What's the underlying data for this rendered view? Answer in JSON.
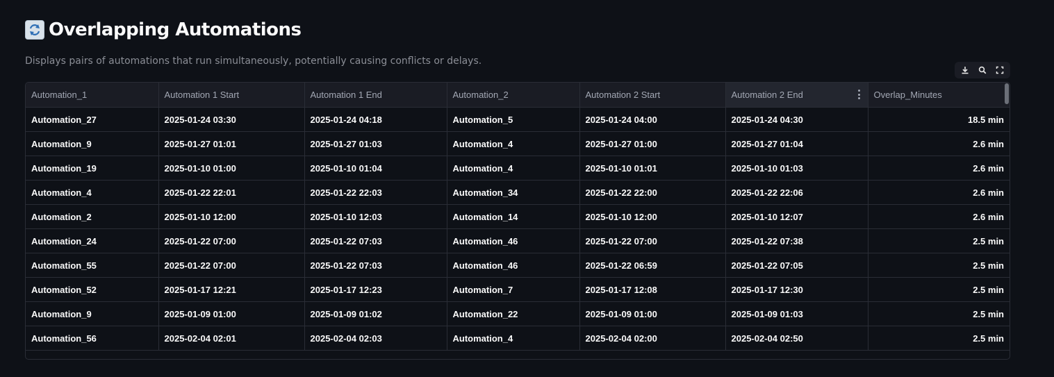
{
  "header": {
    "title": "Overlapping Automations",
    "title_icon": "repeat-arrows-icon",
    "subtitle": "Displays pairs of automations that run simultaneously, potentially causing conflicts or delays."
  },
  "toolbar": {
    "download_icon": "download-icon",
    "search_icon": "search-icon",
    "fullscreen_icon": "fullscreen-icon"
  },
  "table": {
    "columns": [
      "Automation_1",
      "Automation 1 Start",
      "Automation 1 End",
      "Automation_2",
      "Automation 2 Start",
      "Automation 2 End",
      "Overlap_Minutes"
    ],
    "rows": [
      [
        "Automation_27",
        "2025-01-24 03:30",
        "2025-01-24 04:18",
        "Automation_5",
        "2025-01-24 04:00",
        "2025-01-24 04:30",
        "18.5 min"
      ],
      [
        "Automation_9",
        "2025-01-27 01:01",
        "2025-01-27 01:03",
        "Automation_4",
        "2025-01-27 01:00",
        "2025-01-27 01:04",
        "2.6 min"
      ],
      [
        "Automation_19",
        "2025-01-10 01:00",
        "2025-01-10 01:04",
        "Automation_4",
        "2025-01-10 01:01",
        "2025-01-10 01:03",
        "2.6 min"
      ],
      [
        "Automation_4",
        "2025-01-22 22:01",
        "2025-01-22 22:03",
        "Automation_34",
        "2025-01-22 22:00",
        "2025-01-22 22:06",
        "2.6 min"
      ],
      [
        "Automation_2",
        "2025-01-10 12:00",
        "2025-01-10 12:03",
        "Automation_14",
        "2025-01-10 12:00",
        "2025-01-10 12:07",
        "2.6 min"
      ],
      [
        "Automation_24",
        "2025-01-22 07:00",
        "2025-01-22 07:03",
        "Automation_46",
        "2025-01-22 07:00",
        "2025-01-22 07:38",
        "2.5 min"
      ],
      [
        "Automation_55",
        "2025-01-22 07:00",
        "2025-01-22 07:03",
        "Automation_46",
        "2025-01-22 06:59",
        "2025-01-22 07:05",
        "2.5 min"
      ],
      [
        "Automation_52",
        "2025-01-17 12:21",
        "2025-01-17 12:23",
        "Automation_7",
        "2025-01-17 12:08",
        "2025-01-17 12:30",
        "2.5 min"
      ],
      [
        "Automation_9",
        "2025-01-09 01:00",
        "2025-01-09 01:02",
        "Automation_22",
        "2025-01-09 01:00",
        "2025-01-09 01:03",
        "2.5 min"
      ],
      [
        "Automation_56",
        "2025-02-04 02:01",
        "2025-02-04 02:03",
        "Automation_4",
        "2025-02-04 02:00",
        "2025-02-04 02:50",
        "2.5 min"
      ]
    ]
  }
}
